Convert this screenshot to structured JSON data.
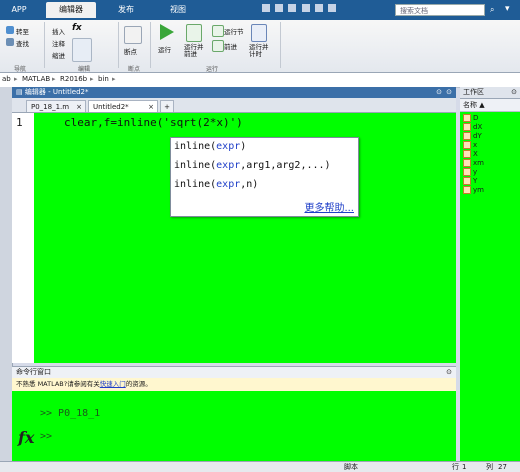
{
  "tabs": {
    "app": "APP",
    "editor": "编辑器",
    "publish": "发布",
    "view": "视图"
  },
  "search": {
    "placeholder": "搜索文档"
  },
  "ribbon": {
    "insert": "插入",
    "fx": "fx",
    "comment": "注释",
    "indent": "缩进",
    "compare": "转至",
    "find": "查找",
    "breakpoint": "断点",
    "run": "运行",
    "run_advance": "运行并\n前进",
    "run_section": "运行节",
    "advance": "前进",
    "run_time": "运行并\n计时",
    "sections": {
      "nav": "导航",
      "edit": "编辑",
      "breakpoints": "断点",
      "run": "运行"
    }
  },
  "address": [
    "ab",
    "MATLAB",
    "R2016b",
    "bin"
  ],
  "editor": {
    "title": "编辑器 - Untitled2*",
    "tabs": [
      "P0_18_1.m",
      "Untitled2*"
    ],
    "add_tab": "+",
    "line_number": "1",
    "code": "clear,f=inline('sqrt(2*x)')",
    "popup": {
      "signatures": [
        {
          "name": "inline(",
          "arg": "expr",
          "rest": ")"
        },
        {
          "name": "inline(",
          "arg": "expr",
          "rest": ",arg1,arg2,...)"
        },
        {
          "name": "inline(",
          "arg": "expr",
          "rest": ",n)"
        }
      ],
      "more_help": "更多帮助..."
    }
  },
  "command": {
    "title": "命令行窗口",
    "info_prefix": "不熟悉 MATLAB?请参阅有关",
    "info_link": "快速入门",
    "info_suffix": "的资源。",
    "history": ">> P0_18_1",
    "prompt": ">>",
    "fx": "fx"
  },
  "workspace": {
    "title": "工作区",
    "column": "名称 ▲",
    "vars": [
      "D",
      "dX",
      "dY",
      "x",
      "X",
      "xm",
      "y",
      "Y",
      "ym"
    ]
  },
  "status": {
    "left": "脚本",
    "row_label": "行",
    "row": "1",
    "col_label": "列",
    "col": "27"
  },
  "colors": {
    "titlebar": "#1f5c96",
    "editor_bg": "#00ff00",
    "link": "#1f3fc8"
  }
}
